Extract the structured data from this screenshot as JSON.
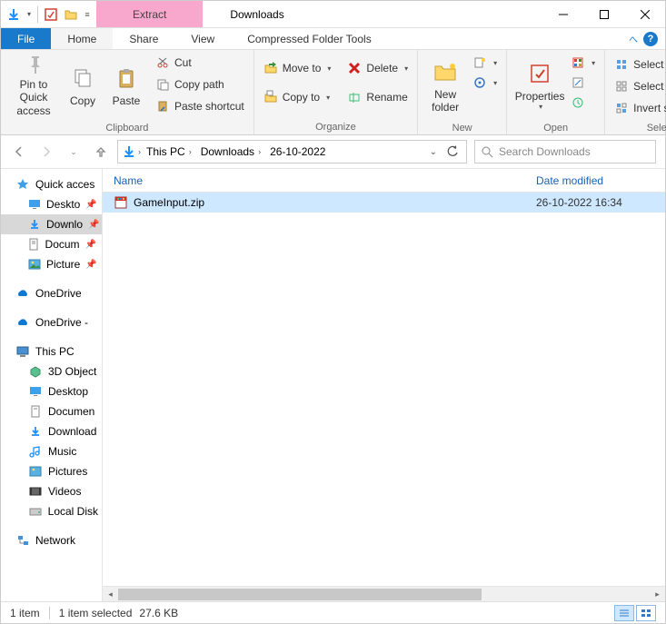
{
  "title": "Downloads",
  "context_tab": "Extract",
  "context_subtitle": "Compressed Folder Tools",
  "tabs": {
    "file": "File",
    "home": "Home",
    "share": "Share",
    "view": "View"
  },
  "ribbon": {
    "clipboard": {
      "label": "Clipboard",
      "pin": "Pin to Quick access",
      "copy": "Copy",
      "paste": "Paste",
      "cut": "Cut",
      "copy_path": "Copy path",
      "paste_shortcut": "Paste shortcut"
    },
    "organize": {
      "label": "Organize",
      "move_to": "Move to",
      "copy_to": "Copy to",
      "delete": "Delete",
      "rename": "Rename"
    },
    "new": {
      "label": "New",
      "new_folder": "New folder"
    },
    "open": {
      "label": "Open",
      "properties": "Properties"
    },
    "select": {
      "label": "Select",
      "select_all": "Select all",
      "select_none": "Select none",
      "invert": "Invert selection"
    }
  },
  "breadcrumbs": [
    "This PC",
    "Downloads",
    "26-10-2022"
  ],
  "search_placeholder": "Search Downloads",
  "columns": {
    "name": "Name",
    "date": "Date modified"
  },
  "files": [
    {
      "name": "GameInput.zip",
      "date": "26-10-2022 16:34"
    }
  ],
  "tree": {
    "quick_access": "Quick acces",
    "qa_items": [
      "Deskto",
      "Downlo",
      "Docum",
      "Picture"
    ],
    "onedrive1": "OneDrive",
    "onedrive2": "OneDrive -",
    "this_pc": "This PC",
    "pc_items": [
      "3D Object",
      "Desktop",
      "Documen",
      "Download",
      "Music",
      "Pictures",
      "Videos",
      "Local Disk"
    ],
    "network": "Network"
  },
  "status": {
    "count": "1 item",
    "selected": "1 item selected",
    "size": "27.6 KB"
  }
}
